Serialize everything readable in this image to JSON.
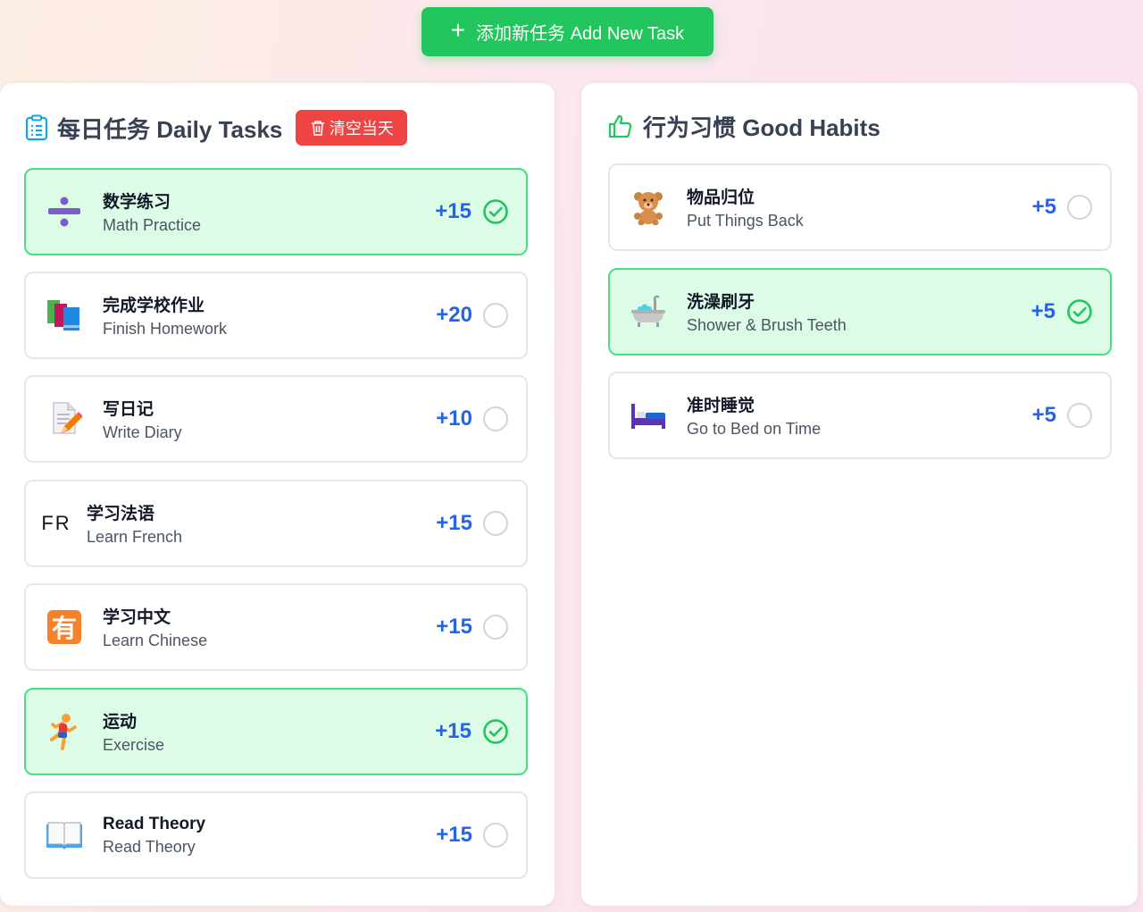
{
  "add_button": {
    "label": "添加新任务 Add New Task"
  },
  "daily": {
    "title": "每日任务 Daily Tasks",
    "clear_label": "清空当天",
    "tasks": [
      {
        "cn": "数学练习",
        "en": "Math Practice",
        "points": "+15",
        "done": true,
        "icon": "divide-icon"
      },
      {
        "cn": "完成学校作业",
        "en": "Finish Homework",
        "points": "+20",
        "done": false,
        "icon": "books-icon"
      },
      {
        "cn": "写日记",
        "en": "Write Diary",
        "points": "+10",
        "done": false,
        "icon": "memo-icon"
      },
      {
        "cn": "学习法语",
        "en": "Learn French",
        "points": "+15",
        "done": false,
        "icon": "fr-icon",
        "icon_text": "FR"
      },
      {
        "cn": "学习中文",
        "en": "Learn Chinese",
        "points": "+15",
        "done": false,
        "icon": "you-character-icon",
        "icon_text": "有"
      },
      {
        "cn": "运动",
        "en": "Exercise",
        "points": "+15",
        "done": true,
        "icon": "runner-icon"
      },
      {
        "cn": "Read Theory",
        "en": "Read Theory",
        "points": "+15",
        "done": false,
        "icon": "open-book-icon"
      }
    ]
  },
  "habits": {
    "title": "行为习惯 Good Habits",
    "items": [
      {
        "cn": "物品归位",
        "en": "Put Things Back",
        "points": "+5",
        "done": false,
        "icon": "teddy-bear-icon"
      },
      {
        "cn": "洗澡刷牙",
        "en": "Shower & Brush Teeth",
        "points": "+5",
        "done": true,
        "icon": "bathtub-icon"
      },
      {
        "cn": "准时睡觉",
        "en": "Go to Bed on Time",
        "points": "+5",
        "done": false,
        "icon": "bed-icon"
      }
    ]
  },
  "colors": {
    "accent_green": "#22c55e",
    "done_bg": "#dcfce7",
    "done_border": "#4ade80",
    "points_blue": "#2563eb",
    "danger": "#ef4444"
  }
}
